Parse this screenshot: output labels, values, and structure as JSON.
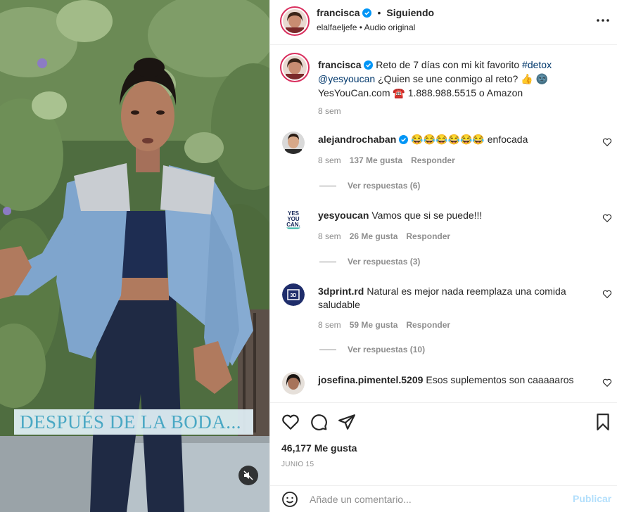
{
  "media": {
    "overlay_text": "DESPUÉS DE LA BODA...",
    "mute_icon": "speaker-muted-icon"
  },
  "header": {
    "username": "francisca",
    "separator": "•",
    "follow_status": "Siguiendo",
    "subtitle_user": "elalfaeljefe",
    "subtitle_separator": "•",
    "subtitle_audio": "Audio original",
    "more_icon": "more-horizontal-icon"
  },
  "caption": {
    "username": "francisca",
    "text_before_tag": "Reto de 7 días con mi kit favorito",
    "hashtag": "#detox",
    "mention": "@yesyoucan",
    "text_after_mention": "¿Quien se une conmigo al reto? 👍 🌚",
    "line3": "YesYouCan.com ☎️ 1.888.988.5515 o Amazon",
    "time": "8 sem"
  },
  "comments": [
    {
      "username": "alejandrochaban",
      "verified": true,
      "text": "😂😂😂😂😂😂 enfocada",
      "time": "8 sem",
      "likes": "137 Me gusta",
      "reply": "Responder",
      "view_replies": "Ver respuestas (6)"
    },
    {
      "username": "yesyoucan",
      "verified": false,
      "text": "Vamos que si se puede!!!",
      "time": "8 sem",
      "likes": "26 Me gusta",
      "reply": "Responder",
      "view_replies": "Ver respuestas (3)"
    },
    {
      "username": "3dprint.rd",
      "verified": false,
      "text": "Natural es mejor nada reemplaza una comida saludable",
      "time": "8 sem",
      "likes": "59 Me gusta",
      "reply": "Responder",
      "view_replies": "Ver respuestas (10)"
    },
    {
      "username": "josefina.pimentel.5209",
      "verified": false,
      "text": "Esos suplementos son caaaaaros"
    }
  ],
  "actions": {
    "likes": "46,177 Me gusta",
    "date": "JUNIO 15"
  },
  "composer": {
    "placeholder": "Añade un comentario...",
    "publish_label": "Publicar"
  },
  "colors": {
    "verified": "#0095f6",
    "link": "#00376b",
    "muted": "#8e8e8e",
    "publish_disabled": "#b2dffc",
    "story_ring": "#d92f5e"
  }
}
